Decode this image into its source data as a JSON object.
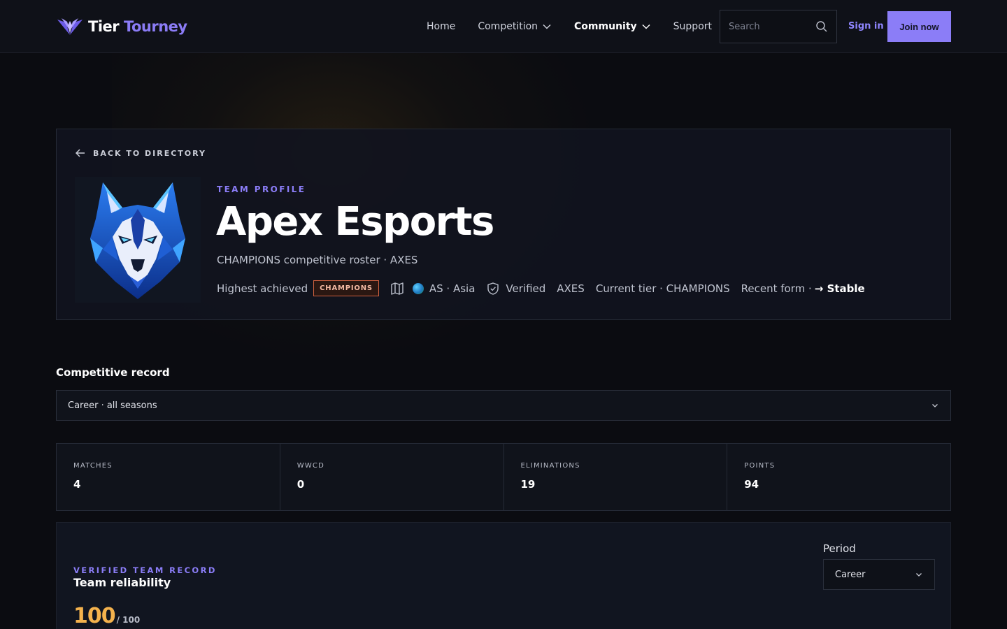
{
  "header": {
    "logo_word1": "Tier",
    "logo_word2": "Tourney",
    "nav": [
      {
        "label": "Home"
      },
      {
        "label": "Competition"
      },
      {
        "label": "Community"
      },
      {
        "label": "Support"
      }
    ],
    "search_placeholder": "Search",
    "signin_label": "Sign in",
    "join_label": "Join now"
  },
  "profile": {
    "back_label": "BACK TO DIRECTORY",
    "eyebrow": "TEAM PROFILE",
    "team_name": "Apex Esports",
    "subtitle": "CHAMPIONS competitive roster · AXES",
    "highest_label": "Highest achieved",
    "highest_badge": "CHAMPIONS",
    "region": "AS · Asia",
    "verified": "Verified",
    "tag": "AXES",
    "current_tier": "Current tier · CHAMPIONS",
    "recent_form_label": "Recent form ·",
    "recent_form_value": "→ Stable"
  },
  "record": {
    "title": "Competitive record",
    "scope_selected": "Career · all seasons",
    "stats": [
      {
        "label": "MATCHES",
        "value": "4"
      },
      {
        "label": "WWCD",
        "value": "0"
      },
      {
        "label": "ELIMINATIONS",
        "value": "19"
      },
      {
        "label": "POINTS",
        "value": "94"
      }
    ]
  },
  "reliability": {
    "eyebrow": "VERIFIED TEAM RECORD",
    "title": "Team reliability",
    "score": "100",
    "score_max": "/ 100",
    "period_label": "Period",
    "period_selected": "Career"
  },
  "colors": {
    "accent": "#8b7df7",
    "score": "#f4b24d",
    "badge_border": "#d0613f",
    "background": "#0b0c11"
  },
  "icons": {
    "logo": "winged-v-logo-icon",
    "search": "search-icon",
    "back": "arrow-left-icon",
    "map": "map-icon",
    "verified": "shield-check-icon",
    "chevron": "chevron-down-icon",
    "emblem": "wolf-head-emblem"
  }
}
